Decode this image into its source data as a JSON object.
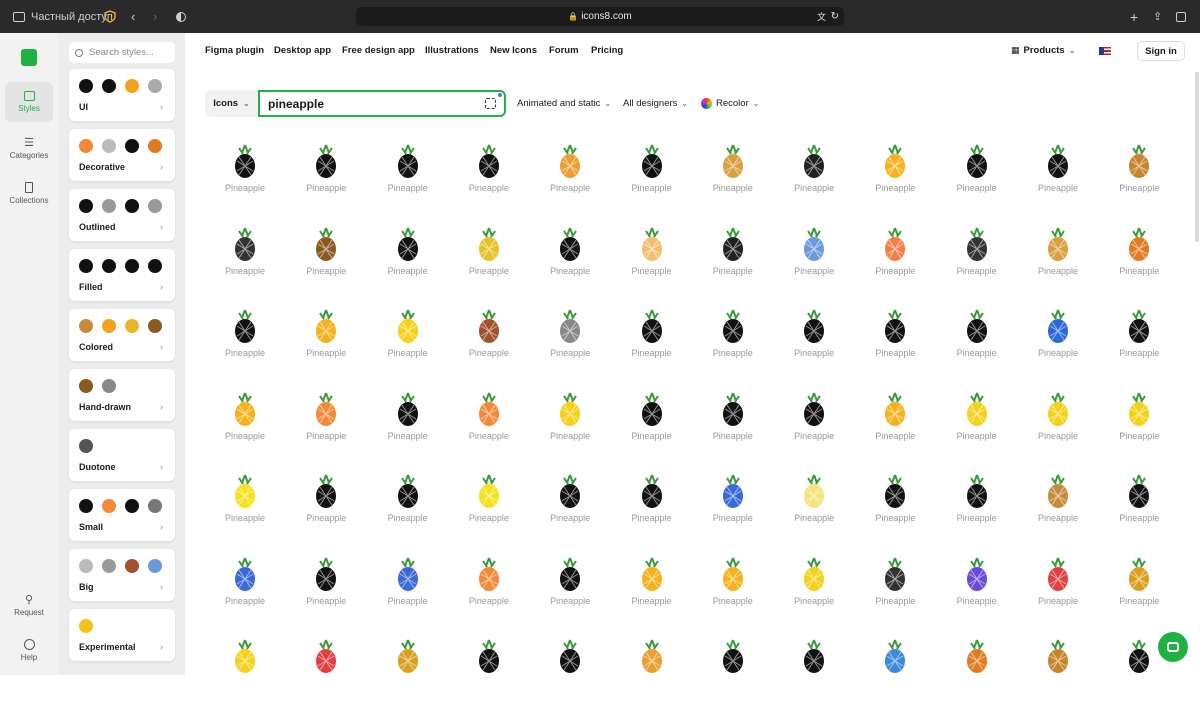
{
  "browser": {
    "profile_label": "Частный доступ",
    "url": "icons8.com"
  },
  "rail": {
    "items": [
      {
        "label": "Styles",
        "icon": "styles-icon"
      },
      {
        "label": "Categories",
        "icon": "categories-icon"
      },
      {
        "label": "Collections",
        "icon": "bookmark-icon"
      },
      {
        "label": "Request",
        "icon": "request-icon"
      },
      {
        "label": "Help",
        "icon": "help-icon"
      }
    ]
  },
  "panel": {
    "search_placeholder": "Search styles...",
    "cards": [
      {
        "label": "UI",
        "swatches": [
          "#111",
          "#111",
          "#f4a21c",
          "#aaa"
        ]
      },
      {
        "label": "Decorative",
        "swatches": [
          "#f28a3a",
          "#bbb",
          "#111",
          "#e07b20"
        ]
      },
      {
        "label": "Outlined",
        "swatches": [
          "#111",
          "#999",
          "#111",
          "#999"
        ]
      },
      {
        "label": "Filled",
        "swatches": [
          "#111",
          "#111",
          "#111",
          "#111"
        ]
      },
      {
        "label": "Colored",
        "swatches": [
          "#c78b3c",
          "#f4a21c",
          "#e9b52b",
          "#8a5a1e"
        ]
      },
      {
        "label": "Hand-drawn",
        "swatches": [
          "#8a5a1e",
          "#888"
        ]
      },
      {
        "label": "Duotone",
        "swatches": [
          "#555"
        ]
      },
      {
        "label": "Small",
        "swatches": [
          "#111",
          "#f28a3a",
          "#111",
          "#777"
        ]
      },
      {
        "label": "Big",
        "swatches": [
          "#bbb",
          "#999",
          "#a0522d",
          "#6a9bd8"
        ]
      },
      {
        "label": "Experimental",
        "swatches": [
          "#f4c21c"
        ]
      }
    ]
  },
  "nav": {
    "links": [
      "Figma plugin",
      "Desktop app",
      "Free design app",
      "Illustrations",
      "New Icons",
      "Forum",
      "Pricing"
    ],
    "products_label": "Products",
    "signin_label": "Sign in"
  },
  "search": {
    "type_label": "Icons",
    "query": "pineapple",
    "filter_animated": "Animated and static",
    "filter_designers": "All designers",
    "filter_recolor": "Recolor"
  },
  "results": {
    "item_label": "Pineapple",
    "rows": [
      [
        "#111",
        "#111",
        "#111",
        "#111",
        "#e9a030",
        "#111",
        "#d9a040",
        "#222",
        "#f4b21c",
        "#111",
        "#111",
        "#c7852b"
      ],
      [
        "#333",
        "#8a5a1e",
        "#111",
        "#e8c22b",
        "#111",
        "#f0c070",
        "#222",
        "#6a9bd8",
        "#f27f4a",
        "#333",
        "#d9a040",
        "#e07b20"
      ],
      [
        "#111",
        "#f4b21c",
        "#f4d21c",
        "#a0522d",
        "#888",
        "#111",
        "#111",
        "#111",
        "#111",
        "#111",
        "#2a6ad8",
        "#111"
      ],
      [
        "#f4b21c",
        "#f28a3a",
        "#111",
        "#f28a3a",
        "#f4d21c",
        "#111",
        "#111",
        "#111",
        "#f4b21c",
        "#f4d21c",
        "#f4d21c",
        "#f4d21c"
      ],
      [
        "#f4e21c",
        "#111",
        "#111",
        "#f4e21c",
        "#111",
        "#111",
        "#3a6ad8",
        "#f4e27c",
        "#111",
        "#111",
        "#c78b3c",
        "#111"
      ],
      [
        "#3a6ad8",
        "#111",
        "#3a6ad8",
        "#f28a3a",
        "#111",
        "#f4b21c",
        "#f4b21c",
        "#f4d21c",
        "#333",
        "#6a4ad8",
        "#e04040",
        "#d9a020"
      ],
      [
        "#f4d21c",
        "#e04040",
        "#d9a020",
        "#111",
        "#111",
        "#e9a030",
        "#111",
        "#111",
        "#3a8ad8",
        "#e07b20",
        "#c7852b",
        "#111"
      ]
    ]
  },
  "colors": {
    "accent": "#1fb141",
    "muted_text": "#999999"
  }
}
